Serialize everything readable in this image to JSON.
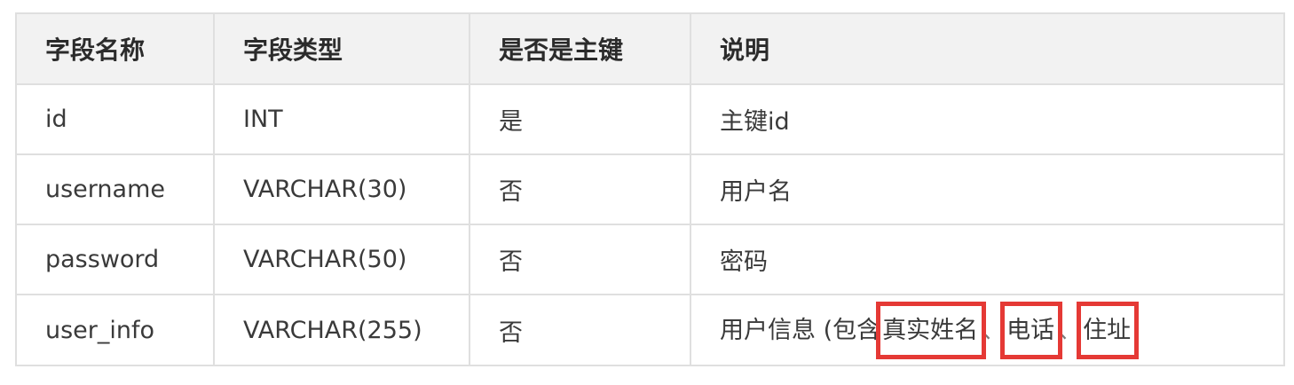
{
  "table": {
    "headers": [
      "字段名称",
      "字段类型",
      "是否是主键",
      "说明"
    ],
    "rows": [
      {
        "name": "id",
        "type": "INT",
        "primary": "是",
        "desc": "主键id"
      },
      {
        "name": "username",
        "type": "VARCHAR(30)",
        "primary": "否",
        "desc": "用户名"
      },
      {
        "name": "password",
        "type": "VARCHAR(50)",
        "primary": "否",
        "desc": "密码"
      },
      {
        "name": "user_info",
        "type": "VARCHAR(255)",
        "primary": "否",
        "desc_prefix": "用户信息 (包含",
        "desc_highlight_1": "真实姓名",
        "desc_sep_1": "、",
        "desc_highlight_2": "电话",
        "desc_sep_2": "、",
        "desc_highlight_3": "住址"
      }
    ]
  },
  "colors": {
    "header_bg": "#f2f2f2",
    "border": "#dfdfdf",
    "highlight_box": "#e53935"
  }
}
